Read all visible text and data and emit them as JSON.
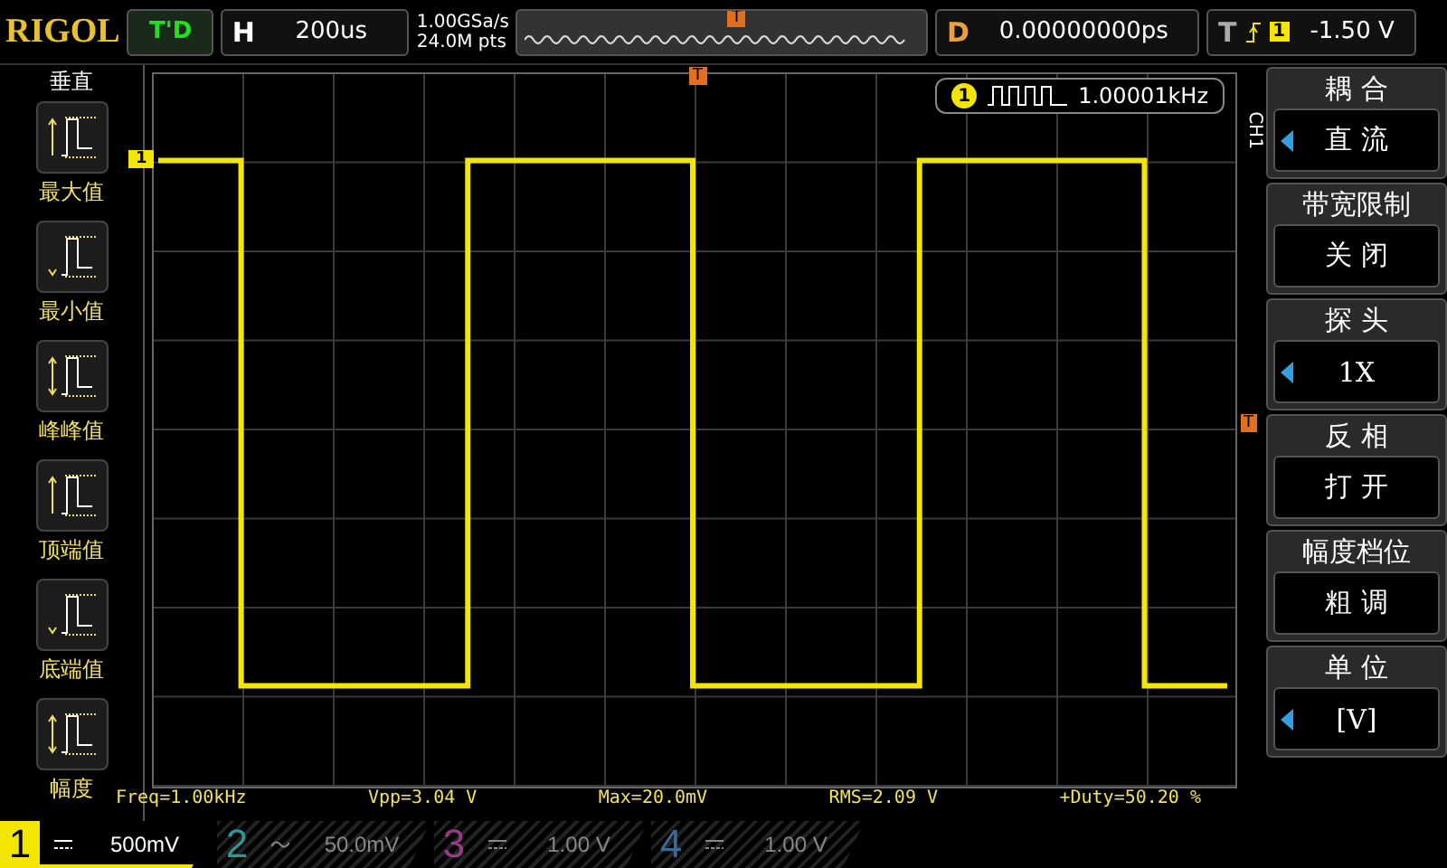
{
  "header": {
    "logo": "RIGOL",
    "run_status": "T'D",
    "horizontal": {
      "label": "H",
      "value": "200us"
    },
    "sample_rate": "1.00GSa/s",
    "memory_depth": "24.0M pts",
    "trigger_marker": "T",
    "delay": {
      "label": "D",
      "value": "0.00000000ps"
    },
    "trigger": {
      "label": "T",
      "source": "1",
      "level": "-1.50 V"
    }
  },
  "left_menu": {
    "title": "垂直",
    "items": [
      {
        "label": "最大值",
        "kind": "max"
      },
      {
        "label": "最小值",
        "kind": "min"
      },
      {
        "label": "峰峰值",
        "kind": "pp"
      },
      {
        "label": "顶端值",
        "kind": "top"
      },
      {
        "label": "底端值",
        "kind": "base"
      },
      {
        "label": "幅度",
        "kind": "pp"
      }
    ]
  },
  "screen": {
    "channel_marker": "1",
    "trigger_time_marker": "T",
    "trigger_level_marker": "T",
    "counter": {
      "channel": "1",
      "value": "1.00001kHz"
    },
    "channel_label": "CH1"
  },
  "measurements": [
    "Freq=1.00kHz",
    "Vpp=3.04 V",
    "Max=20.0mV",
    "RMS=2.09 V",
    "+Duty=50.20 %"
  ],
  "right_menu": {
    "items": [
      {
        "title": "耦 合",
        "value": "直 流",
        "adjustable": true
      },
      {
        "title": "带宽限制",
        "value": "关 闭",
        "adjustable": false
      },
      {
        "title": "探 头",
        "value": "1X",
        "adjustable": true
      },
      {
        "title": "反 相",
        "value": "打 开",
        "adjustable": false
      },
      {
        "title": "幅度档位",
        "value": "粗 调",
        "adjustable": false
      },
      {
        "title": "单 位",
        "value": "[V]",
        "adjustable": true
      }
    ]
  },
  "channels": [
    {
      "number": "1",
      "kind": "dc",
      "scale": "500mV",
      "selected": true,
      "color": "#f5e600"
    },
    {
      "number": "2",
      "kind": "ac",
      "scale": "50.0mV",
      "selected": false,
      "color": "#2a9a96"
    },
    {
      "number": "3",
      "kind": "dc",
      "scale": "1.00 V",
      "selected": false,
      "color": "#9a3a88"
    },
    {
      "number": "4",
      "kind": "dc",
      "scale": "1.00 V",
      "selected": false,
      "color": "#3a6a9a"
    }
  ]
}
